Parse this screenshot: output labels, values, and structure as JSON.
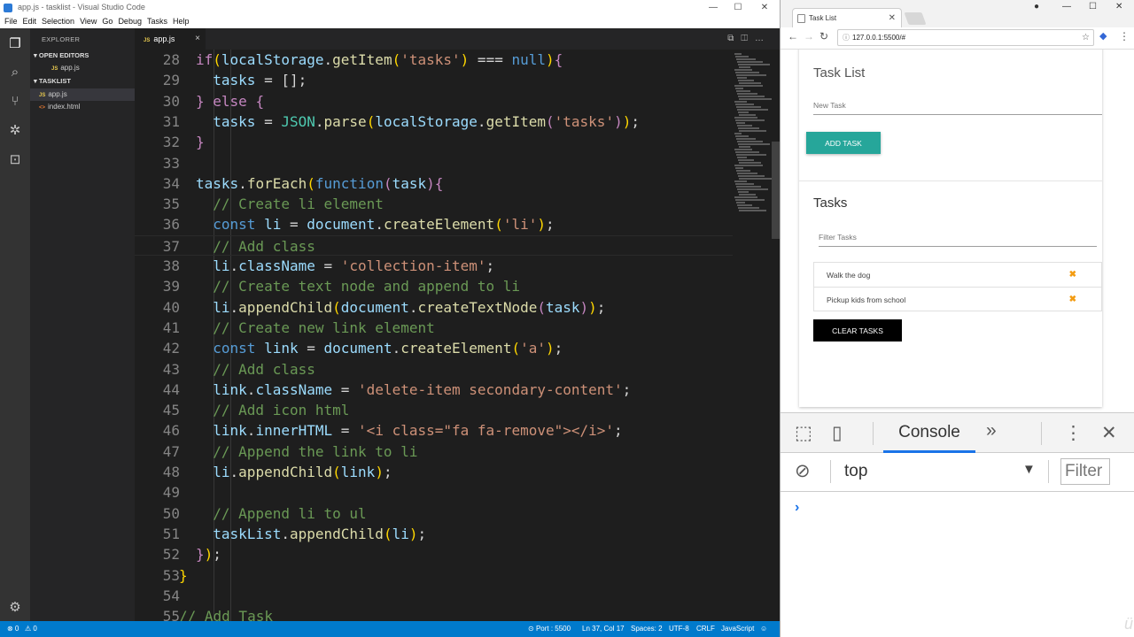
{
  "vscode": {
    "window_title": "app.js - tasklist - Visual Studio Code",
    "menu": [
      "File",
      "Edit",
      "Selection",
      "View",
      "Go",
      "Debug",
      "Tasks",
      "Help"
    ],
    "explorer": {
      "title": "EXPLORER",
      "open_editors_label": "OPEN EDITORS",
      "open_editors": [
        "app.js"
      ],
      "project_label": "TASKLIST",
      "files": [
        "app.js",
        "index.html"
      ]
    },
    "tab": {
      "label": "app.js",
      "close": "×"
    },
    "lines": [
      {
        "n": "28",
        "h": "<span class='k'>if</span><span class='y'>(</span><span class='v'>localStorage</span><span class='p'>.</span><span class='f'>getItem</span><span class='y'>(</span><span class='s'>'tasks'</span><span class='y'>)</span><span class='p'> === </span><span class='kb'>null</span><span class='y'>)</span><span class='k'>{</span>"
      },
      {
        "n": "29",
        "h": "<span class='p'>  </span><span class='v'>tasks</span><span class='p'> = [];</span>"
      },
      {
        "n": "30",
        "h": "<span class='k'>}</span><span class='p'> </span><span class='k'>else</span><span class='p'> </span><span class='k'>{</span>"
      },
      {
        "n": "31",
        "h": "<span class='p'>  </span><span class='v'>tasks</span><span class='p'> = </span><span class='cl'>JSON</span><span class='p'>.</span><span class='f'>parse</span><span class='y'>(</span><span class='v'>localStorage</span><span class='p'>.</span><span class='f'>getItem</span><span class='k'>(</span><span class='s'>'tasks'</span><span class='k'>)</span><span class='y'>)</span><span class='p'>;</span>"
      },
      {
        "n": "32",
        "h": "<span class='k'>}</span>"
      },
      {
        "n": "33",
        "h": ""
      },
      {
        "n": "34",
        "h": "<span class='v'>tasks</span><span class='p'>.</span><span class='f'>forEach</span><span class='y'>(</span><span class='kb'>function</span><span class='k'>(</span><span class='v'>task</span><span class='k'>){</span>"
      },
      {
        "n": "35",
        "h": "<span class='p'>  </span><span class='c'>// Create li element</span>"
      },
      {
        "n": "36",
        "h": "<span class='p'>  </span><span class='kb'>const</span><span class='p'> </span><span class='v'>li</span><span class='p'> = </span><span class='v'>document</span><span class='p'>.</span><span class='f'>createElement</span><span class='y'>(</span><span class='s'>'li'</span><span class='y'>)</span><span class='p'>;</span>"
      },
      {
        "n": "37",
        "h": "<span class='p'>  </span><span class='c'>// Add class</span>",
        "current": true
      },
      {
        "n": "38",
        "h": "<span class='p'>  </span><span class='v'>li</span><span class='p'>.</span><span class='v'>className</span><span class='p'> = </span><span class='s'>'collection-item'</span><span class='p'>;</span>"
      },
      {
        "n": "39",
        "h": "<span class='p'>  </span><span class='c'>// Create text node and append to li</span>"
      },
      {
        "n": "40",
        "h": "<span class='p'>  </span><span class='v'>li</span><span class='p'>.</span><span class='f'>appendChild</span><span class='y'>(</span><span class='v'>document</span><span class='p'>.</span><span class='f'>createTextNode</span><span class='k'>(</span><span class='v'>task</span><span class='k'>)</span><span class='y'>)</span><span class='p'>;</span>"
      },
      {
        "n": "41",
        "h": "<span class='p'>  </span><span class='c'>// Create new link element</span>"
      },
      {
        "n": "42",
        "h": "<span class='p'>  </span><span class='kb'>const</span><span class='p'> </span><span class='v'>link</span><span class='p'> = </span><span class='v'>document</span><span class='p'>.</span><span class='f'>createElement</span><span class='y'>(</span><span class='s'>'a'</span><span class='y'>)</span><span class='p'>;</span>"
      },
      {
        "n": "43",
        "h": "<span class='p'>  </span><span class='c'>// Add class</span>"
      },
      {
        "n": "44",
        "h": "<span class='p'>  </span><span class='v'>link</span><span class='p'>.</span><span class='v'>className</span><span class='p'> = </span><span class='s'>'delete-item secondary-content'</span><span class='p'>;</span>"
      },
      {
        "n": "45",
        "h": "<span class='p'>  </span><span class='c'>// Add icon html</span>"
      },
      {
        "n": "46",
        "h": "<span class='p'>  </span><span class='v'>link</span><span class='p'>.</span><span class='v'>innerHTML</span><span class='p'> = </span><span class='s'>'&lt;i class=\"fa fa-remove\"&gt;&lt;/i&gt;'</span><span class='p'>;</span>"
      },
      {
        "n": "47",
        "h": "<span class='p'>  </span><span class='c'>// Append the link to li</span>"
      },
      {
        "n": "48",
        "h": "<span class='p'>  </span><span class='v'>li</span><span class='p'>.</span><span class='f'>appendChild</span><span class='y'>(</span><span class='v'>link</span><span class='y'>)</span><span class='p'>;</span>"
      },
      {
        "n": "49",
        "h": ""
      },
      {
        "n": "50",
        "h": "<span class='p'>  </span><span class='c'>// Append li to ul</span>"
      },
      {
        "n": "51",
        "h": "<span class='p'>  </span><span class='v'>taskList</span><span class='p'>.</span><span class='f'>appendChild</span><span class='y'>(</span><span class='v'>li</span><span class='y'>)</span><span class='p'>;</span>"
      },
      {
        "n": "52",
        "h": "<span class='k'>}</span><span class='y'>)</span><span class='p'>;</span>"
      },
      {
        "n": "53",
        "h": "<span class='y'>}</span>",
        "outdent": true
      },
      {
        "n": "54",
        "h": ""
      },
      {
        "n": "55",
        "h": "<span class='c'>// Add Task</span>",
        "outdent": true
      }
    ],
    "status": {
      "errors": "⊗ 0",
      "warnings": "⚠ 0",
      "port": "Port : 5500",
      "position": "Ln 37, Col 17",
      "spaces": "Spaces: 2",
      "encoding": "UTF-8",
      "eol": "CRLF",
      "language": "JavaScript"
    }
  },
  "chrome": {
    "tab_title": "Task List",
    "url": "127.0.0.1:5500/#",
    "page": {
      "title": "Task List",
      "new_task_placeholder": "New Task",
      "add_button": "ADD TASK",
      "tasks_heading": "Tasks",
      "filter_placeholder": "Filter Tasks",
      "tasks": [
        "Walk the dog",
        "Pickup kids from school"
      ],
      "clear_button": "CLEAR TASKS"
    },
    "devtools": {
      "tab": "Console",
      "more": "»",
      "context": "top",
      "filter": "Filter",
      "prompt": "›"
    }
  }
}
